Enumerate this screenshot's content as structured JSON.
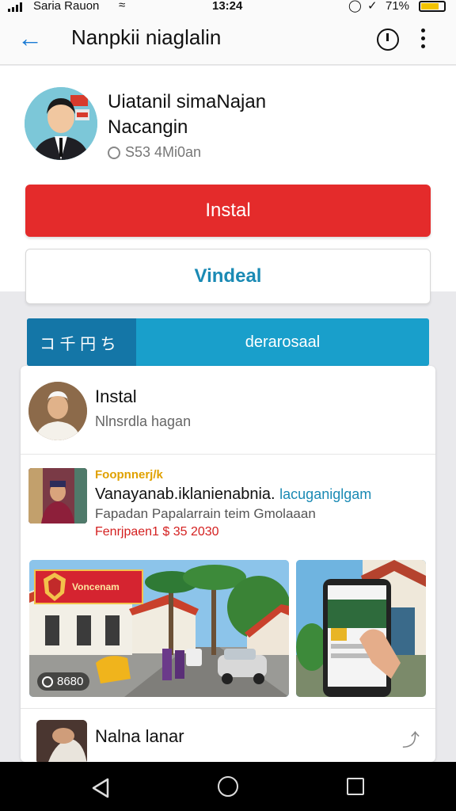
{
  "status_bar": {
    "carrier": "Saria Rauon",
    "time": "13:24",
    "battery_text": "71%",
    "battery_color": "#f2c300"
  },
  "app_bar": {
    "back_icon": "arrow-left-icon",
    "title": "Nanpkii niaglalin",
    "accent": "#1a7ad4"
  },
  "header": {
    "app_name_line1": "Uiatanil simaNajan",
    "app_name_line2": "Nacangin",
    "meta": "S53 4Mi0an",
    "install_label": "Instal",
    "install_color": "#e42b2b",
    "video_label": "Vindeal",
    "video_color": "#1a8ab4"
  },
  "tabs": {
    "left": "コ 千 円 ち",
    "right": "derarosaal",
    "bar_color": "#199fcb"
  },
  "feed": {
    "item1": {
      "name": "Instal",
      "sub": "Nlnsrdla hagan"
    },
    "item2": {
      "kicker": "Foopnnerj/k",
      "head": "Vanayanab.iklanienabnia.",
      "head_link": "lacuganiglgam",
      "desc": "Fapadan Papalarrain teim Gmolaaan",
      "price": "Fenrjpaen1 $ 35 2030",
      "price_color": "#d42020"
    },
    "screenshot1": {
      "banner": "Voncenam",
      "count": "8680"
    },
    "item3": {
      "name": "Nalna lanar"
    }
  }
}
